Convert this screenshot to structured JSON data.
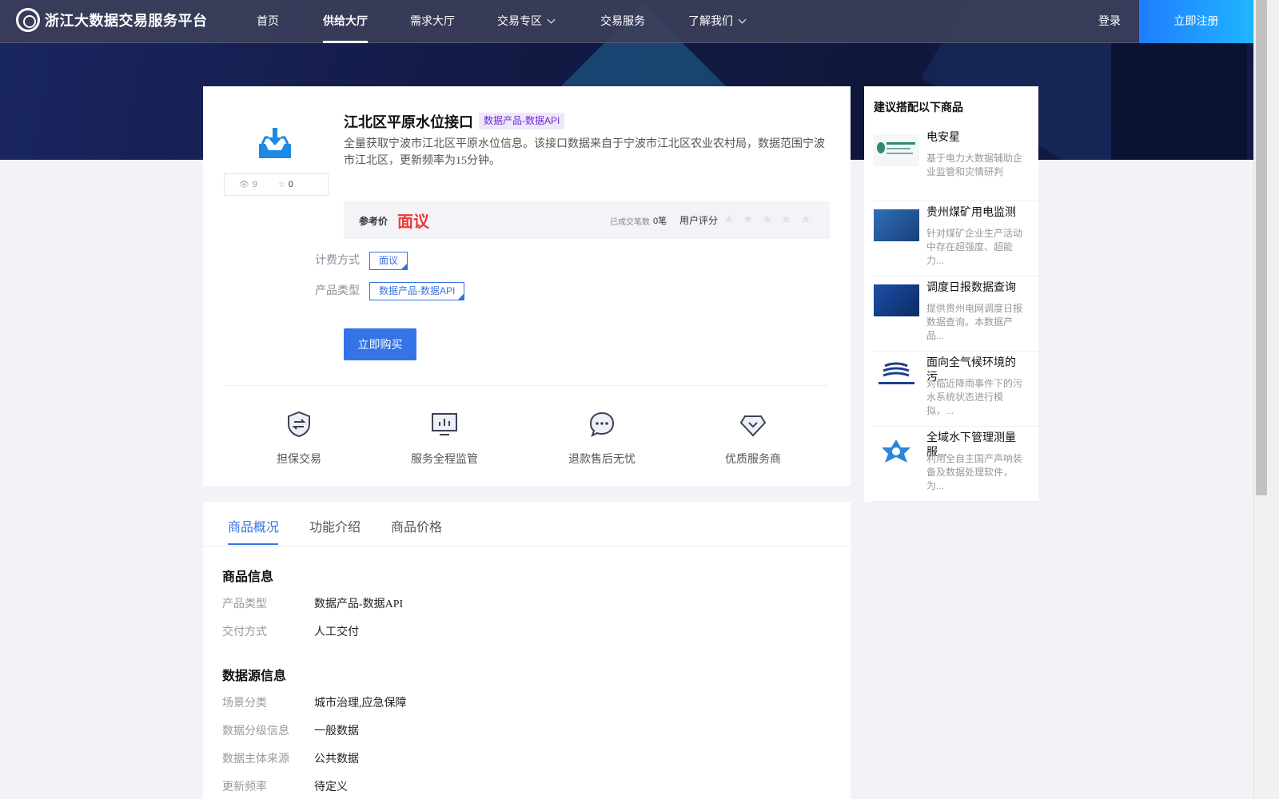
{
  "nav": {
    "logo_text": "浙江大数据交易服务平台",
    "items": [
      "首页",
      "供给大厅",
      "需求大厅",
      "交易专区",
      "交易服务",
      "了解我们"
    ],
    "login": "登录",
    "register": "立即注册"
  },
  "product": {
    "title": "江北区平原水位接口",
    "tag": "数据产品-数据API",
    "description": "全量获取宁波市江北区平原水位信息。该接口数据来自于宁波市江北区农业农村局，数据范围宁波市江北区，更新频率为15分钟。",
    "views": "9",
    "favorites": "0",
    "price_label": "参考价",
    "price": "面议",
    "deals_label": "已成交笔数",
    "deals": "0笔",
    "rating_label": "用户评分",
    "rating": 0,
    "billing_label": "计费方式",
    "billing_value": "面议",
    "type_label": "产品类型",
    "type_value": "数据产品-数据API",
    "buy_button": "立即购买"
  },
  "features": [
    {
      "label": "担保交易",
      "icon": "shield-exchange-icon"
    },
    {
      "label": "服务全程监管",
      "icon": "monitor-chart-icon"
    },
    {
      "label": "退款售后无忧",
      "icon": "chat-bubble-icon"
    },
    {
      "label": "优质服务商",
      "icon": "diamond-icon"
    }
  ],
  "recommend": {
    "title": "建议搭配以下商品",
    "items": [
      {
        "name": "电安星",
        "desc": "基于电力大数据辅助企业监管和灾情研判"
      },
      {
        "name": "贵州煤矿用电监测",
        "desc": "针对煤矿企业生产活动中存在超强度、超能力..."
      },
      {
        "name": "调度日报数据查询",
        "desc": "提供贵州电网调度日报数据查询。本数据产品..."
      },
      {
        "name": "面向全气候环境的污...",
        "desc": "对临近降雨事件下的污水系统状态进行模拟，..."
      },
      {
        "name": "全域水下管理测量服...",
        "desc": "利用全自主国产声呐装备及数据处理软件，为..."
      }
    ]
  },
  "tabs": [
    "商品概况",
    "功能介绍",
    "商品价格"
  ],
  "goods_info": {
    "title": "商品信息",
    "rows": [
      {
        "k": "产品类型",
        "v": "数据产品-数据API"
      },
      {
        "k": "交付方式",
        "v": "人工交付"
      }
    ]
  },
  "source_info": {
    "title": "数据源信息",
    "rows": [
      {
        "k": "场景分类",
        "v": "城市治理,应急保障"
      },
      {
        "k": "数据分级信息",
        "v": "一般数据"
      },
      {
        "k": "数据主体来源",
        "v": "公共数据"
      },
      {
        "k": "更新频率",
        "v": "待定义"
      }
    ]
  },
  "colors": {
    "accent": "#3474e6",
    "price": "#ec3a3a",
    "tag_bg": "#efe8fb",
    "tag_text": "#6b2ad6"
  }
}
